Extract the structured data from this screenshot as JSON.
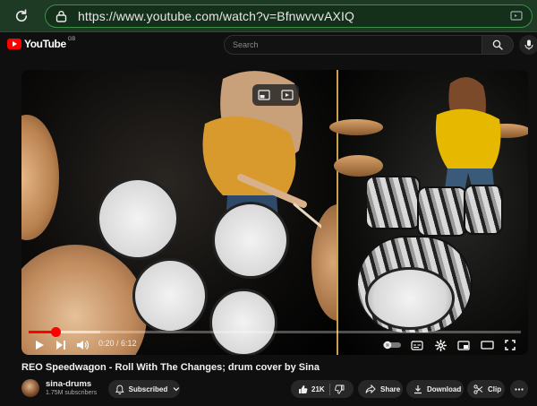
{
  "browser": {
    "url": "https://www.youtube.com/watch?v=BfnwvvvAXIQ"
  },
  "header": {
    "logo_text": "YouTube",
    "region_code": "GB",
    "search_placeholder": "Search"
  },
  "player": {
    "progress_fraction": 0.055,
    "buffer_fraction": 0.145,
    "time_current": "0:20",
    "time_separator": " / ",
    "time_total": "6:12"
  },
  "video": {
    "title": "REO Speedwagon - Roll With The Changes; drum cover by Sina"
  },
  "channel": {
    "name": "sina-drums",
    "subscribers": "1.75M subscribers",
    "subscribe_label": "Subscribed"
  },
  "actions": {
    "likes": "21K",
    "share": "Share",
    "download": "Download",
    "clip": "Clip"
  },
  "colors": {
    "accent": "#ff0000",
    "browser_bar": "#1f3a24",
    "url_border": "#3e8f49",
    "page_bg": "#0f0f0f",
    "pill_bg": "#272727"
  }
}
